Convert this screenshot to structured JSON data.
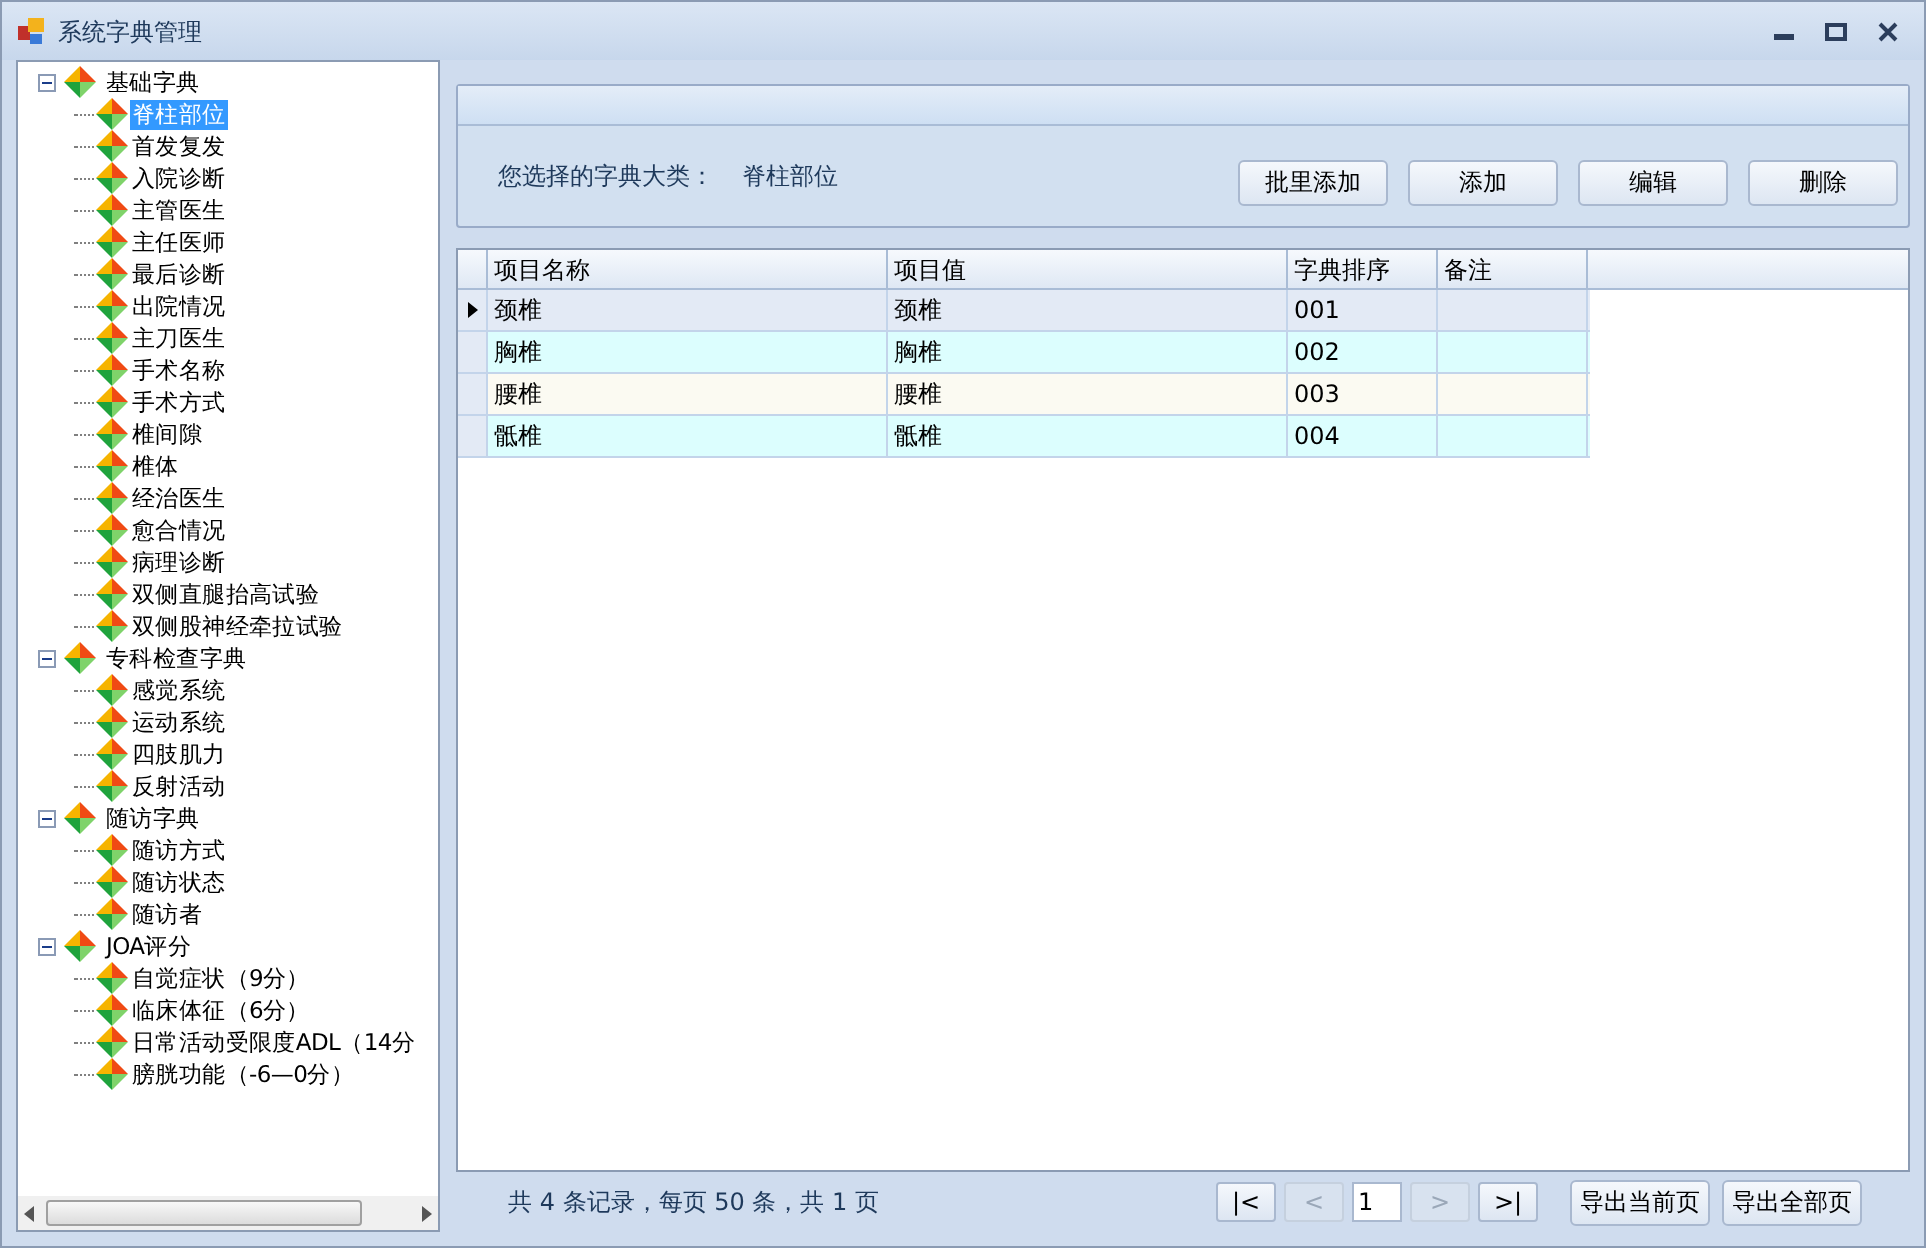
{
  "window": {
    "title": "系统字典管理"
  },
  "tree": [
    {
      "label": "基础字典",
      "expanded": true,
      "selected": false,
      "children": [
        {
          "label": "脊柱部位",
          "selected": true
        },
        {
          "label": "首发复发",
          "selected": false
        },
        {
          "label": "入院诊断",
          "selected": false
        },
        {
          "label": "主管医生",
          "selected": false
        },
        {
          "label": "主任医师",
          "selected": false
        },
        {
          "label": "最后诊断",
          "selected": false
        },
        {
          "label": "出院情况",
          "selected": false
        },
        {
          "label": "主刀医生",
          "selected": false
        },
        {
          "label": "手术名称",
          "selected": false
        },
        {
          "label": "手术方式",
          "selected": false
        },
        {
          "label": "椎间隙",
          "selected": false
        },
        {
          "label": "椎体",
          "selected": false
        },
        {
          "label": "经治医生",
          "selected": false
        },
        {
          "label": "愈合情况",
          "selected": false
        },
        {
          "label": "病理诊断",
          "selected": false
        },
        {
          "label": "双侧直腿抬高试验",
          "selected": false
        },
        {
          "label": "双侧股神经牵拉试验",
          "selected": false
        }
      ]
    },
    {
      "label": "专科检查字典",
      "expanded": true,
      "selected": false,
      "children": [
        {
          "label": "感觉系统",
          "selected": false
        },
        {
          "label": "运动系统",
          "selected": false
        },
        {
          "label": "四肢肌力",
          "selected": false
        },
        {
          "label": "反射活动",
          "selected": false
        }
      ]
    },
    {
      "label": "随访字典",
      "expanded": true,
      "selected": false,
      "children": [
        {
          "label": "随访方式",
          "selected": false
        },
        {
          "label": "随访状态",
          "selected": false
        },
        {
          "label": "随访者",
          "selected": false
        }
      ]
    },
    {
      "label": "JOA评分",
      "expanded": true,
      "selected": false,
      "children": [
        {
          "label": "自觉症状（9分）",
          "selected": false
        },
        {
          "label": "临床体征（6分）",
          "selected": false
        },
        {
          "label": "日常活动受限度ADL（14分",
          "selected": false
        },
        {
          "label": "膀胱功能（-6—0分）",
          "selected": false
        }
      ]
    }
  ],
  "selection": {
    "label": "您选择的字典大类：",
    "value": "脊柱部位"
  },
  "buttons": [
    "批里添加",
    "添加",
    "编辑",
    "删除"
  ],
  "table": {
    "columns": [
      "项目名称",
      "项目值",
      "字典排序",
      "备注"
    ],
    "rows": [
      {
        "cells": [
          "颈椎",
          "颈椎",
          "001",
          ""
        ],
        "selected": true,
        "color": "#e3eaf5"
      },
      {
        "cells": [
          "胸椎",
          "胸椎",
          "002",
          ""
        ],
        "selected": false,
        "color": "#dcfefe"
      },
      {
        "cells": [
          "腰椎",
          "腰椎",
          "003",
          ""
        ],
        "selected": false,
        "color": "#fbfaf2"
      },
      {
        "cells": [
          "骶椎",
          "骶椎",
          "004",
          ""
        ],
        "selected": false,
        "color": "#dcfefe"
      }
    ]
  },
  "pager": {
    "summary": "共 4 条记录，每页 50 条，共 1 页",
    "nav": [
      {
        "label": "|<",
        "disabled": false
      },
      {
        "label": "<",
        "disabled": true
      },
      {
        "kind": "page",
        "value": "1"
      },
      {
        "label": ">",
        "disabled": true
      },
      {
        "label": ">|",
        "disabled": false
      }
    ],
    "exports": [
      "导出当前页",
      "导出全部页"
    ]
  }
}
